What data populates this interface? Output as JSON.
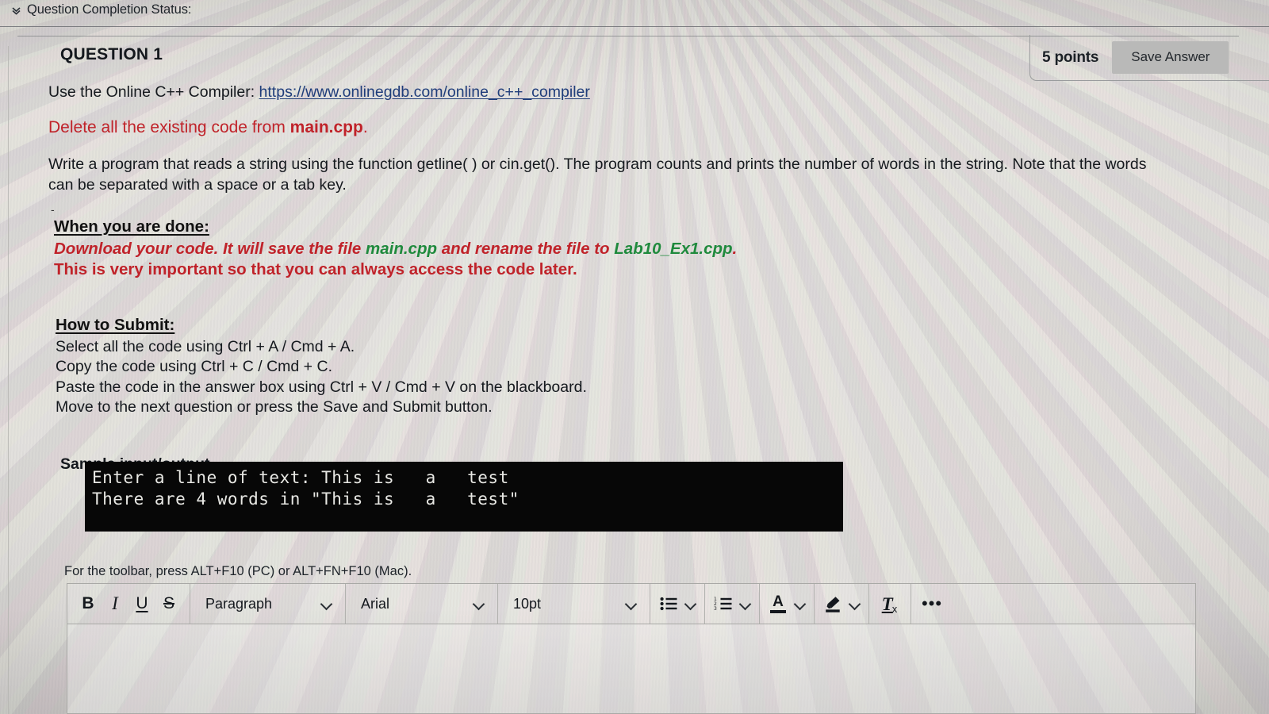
{
  "status_bar": {
    "chevron_icon": "double-chevron-down-icon",
    "label": "Question Completion Status:"
  },
  "question": {
    "title": "QUESTION 1",
    "points_label": "5 points",
    "save_answer_label": "Save Answer",
    "compiler_prefix": "Use the Online C++ Compiler: ",
    "compiler_link_text": "https://www.onlinegdb.com/online_c++_compiler",
    "delete_line_prefix": "Delete all the existing code from ",
    "delete_line_file": "main.cpp",
    "delete_line_suffix": ".",
    "write_paragraph": "Write a program that reads a string using the function getline( ) or cin.get(). The program counts and prints the number of words in the string. Note that the words can be separated with a space or a tab key.",
    "dash_mark": "-",
    "when_done_heading": "When you are done:",
    "done_line_1_a": "Download your code. It will save the file ",
    "done_line_1_file1": "main.cpp",
    "done_line_1_b": " and rename the file to ",
    "done_line_1_file2": "Lab10_Ex1.cpp",
    "done_line_1_c": ".",
    "done_line_2": "This is very important so that you can always access the code later.",
    "how_to_submit_heading": "How to Submit:",
    "submit_steps": [
      "Select all the code using Ctrl + A / Cmd + A.",
      "Copy the code using Ctrl + C / Cmd + C.",
      "Paste the code in the answer box using Ctrl + V / Cmd + V on the blackboard.",
      "Move to the next question or press the Save and Submit button."
    ],
    "sample_heading": "Sample input/output",
    "console": {
      "line_1": "Enter a line of text: This is   a   test",
      "line_2": "There are 4 words in \"This is   a   test\""
    }
  },
  "editor": {
    "toolbar_hint": "For the toolbar, press ALT+F10 (PC) or ALT+FN+F10 (Mac).",
    "bold_label": "B",
    "italic_label": "I",
    "underline_label": "U",
    "strikethrough_label": "S",
    "paragraph_value": "Paragraph",
    "font_value": "Arial",
    "size_value": "10pt",
    "bullet_list_icon": "bulleted-list-icon",
    "numbered_list_icon": "numbered-list-icon",
    "text_color_label": "A",
    "text_color_icon": "text-color-icon",
    "highlight_icon": "highlighter-icon",
    "clear_format_label": "T",
    "clear_format_sub": "x",
    "clear_format_icon": "clear-formatting-icon",
    "more_options_label": "•••",
    "more_options_icon": "more-options-icon",
    "body_value": ""
  },
  "colors": {
    "red_text": "#c0232a",
    "green_text": "#1f8a3d",
    "link": "#1f3d7a",
    "console_bg": "#070707",
    "console_fg": "#e8e8e4",
    "button_bg": "#b9b9b8"
  }
}
